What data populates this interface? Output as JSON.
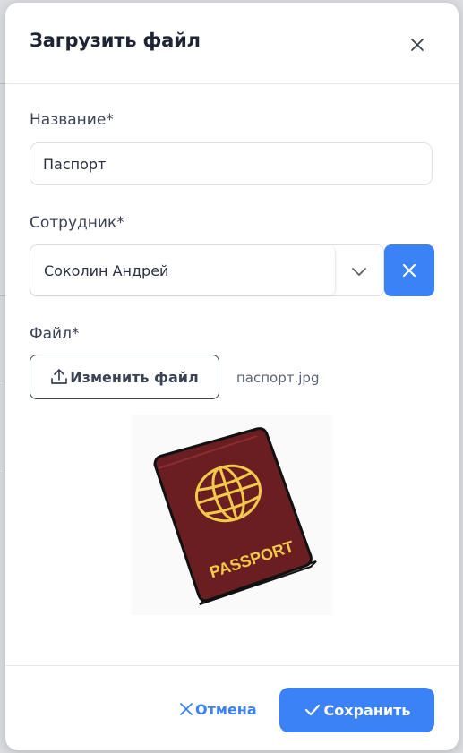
{
  "modal": {
    "title": "Загрузить файл",
    "close_icon": "close-icon"
  },
  "form": {
    "name": {
      "label": "Название*",
      "value": "Паспорт"
    },
    "employee": {
      "label": "Сотрудник*",
      "selected": "Соколин Андрей",
      "chevron_icon": "chevron-down-icon",
      "clear_icon": "close-icon"
    },
    "file": {
      "label": "Файл*",
      "button_label": "Изменить файл",
      "button_icon": "upload-icon",
      "file_name": "паспорт.jpg",
      "preview_text": "PASSPORT"
    }
  },
  "footer": {
    "cancel_label": "Отмена",
    "save_label": "Сохранить"
  },
  "colors": {
    "accent": "#3b82f6",
    "passport_cover": "#6b1e22",
    "passport_emblem": "#f2c94c"
  }
}
